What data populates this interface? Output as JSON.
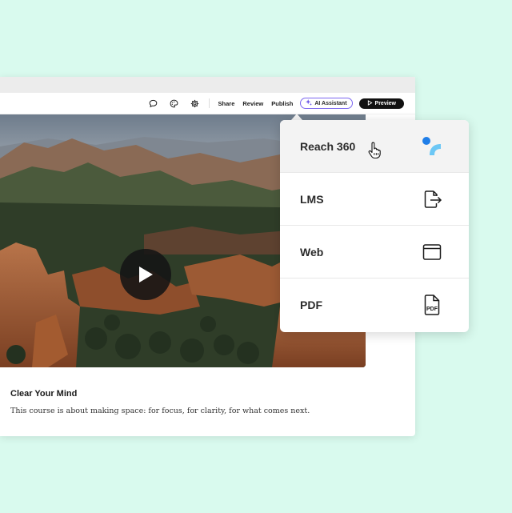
{
  "toolbar": {
    "share_label": "Share",
    "review_label": "Review",
    "publish_label": "Publish",
    "ai_assistant_label": "AI Assistant",
    "preview_label": "Preview"
  },
  "course": {
    "title": "Clear Your Mind",
    "description": "This course is about making space: for focus, for clarity, for what comes next."
  },
  "publish_menu": {
    "items": [
      {
        "label": "Reach 360",
        "icon": "reach360-logo-icon",
        "hovered": true
      },
      {
        "label": "LMS",
        "icon": "export-file-icon"
      },
      {
        "label": "Web",
        "icon": "browser-window-icon"
      },
      {
        "label": "PDF",
        "icon": "pdf-file-icon"
      }
    ]
  },
  "colors": {
    "background": "#d9faee",
    "ai_border": "#7b66f0",
    "reach_blue_dark": "#1f7ee8",
    "reach_blue_light": "#6cc7f5"
  }
}
